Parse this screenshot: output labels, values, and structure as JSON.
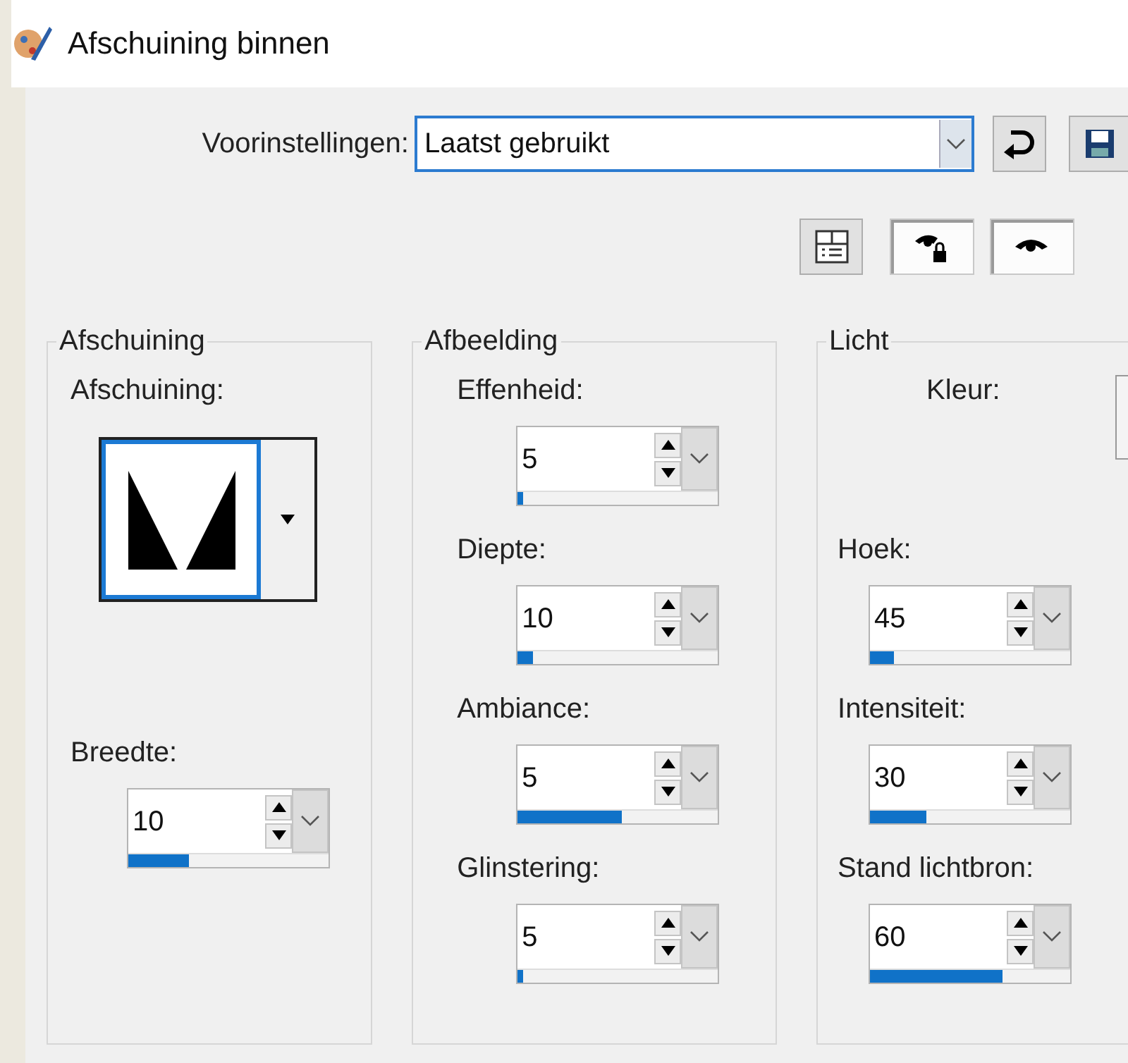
{
  "window": {
    "title": "Afschuining binnen"
  },
  "presets": {
    "label": "Voorinstellingen:",
    "value": "Laatst gebruikt",
    "buttons": [
      {
        "kind": "reset"
      },
      {
        "kind": "save"
      }
    ]
  },
  "toggles": [
    {
      "kind": "layout",
      "on": false
    },
    {
      "kind": "lock-preview",
      "on": true
    },
    {
      "kind": "preview",
      "on": true
    }
  ],
  "bevel_group": {
    "title": "Afschuining",
    "bevel_label": "Afschuining:",
    "width_field": {
      "label": "Breedte:",
      "value": "10",
      "level": 0.3
    }
  },
  "image_group": {
    "title": "Afbeelding",
    "fields": [
      {
        "label": "Effenheid:",
        "value": "5",
        "level": 0.03
      },
      {
        "label": "Diepte:",
        "value": "10",
        "level": 0.08
      },
      {
        "label": "Ambiance:",
        "value": "5",
        "level": 0.52
      },
      {
        "label": "Glinstering:",
        "value": "5",
        "level": 0.03
      }
    ]
  },
  "light_group": {
    "title": "Licht",
    "color_label": "Kleur:",
    "fields": [
      {
        "label": "Hoek:",
        "value": "45",
        "level": 0.12
      },
      {
        "label": "Intensiteit:",
        "value": "30",
        "level": 0.28
      },
      {
        "label": "Stand lichtbron:",
        "value": "60",
        "level": 0.66
      }
    ]
  }
}
